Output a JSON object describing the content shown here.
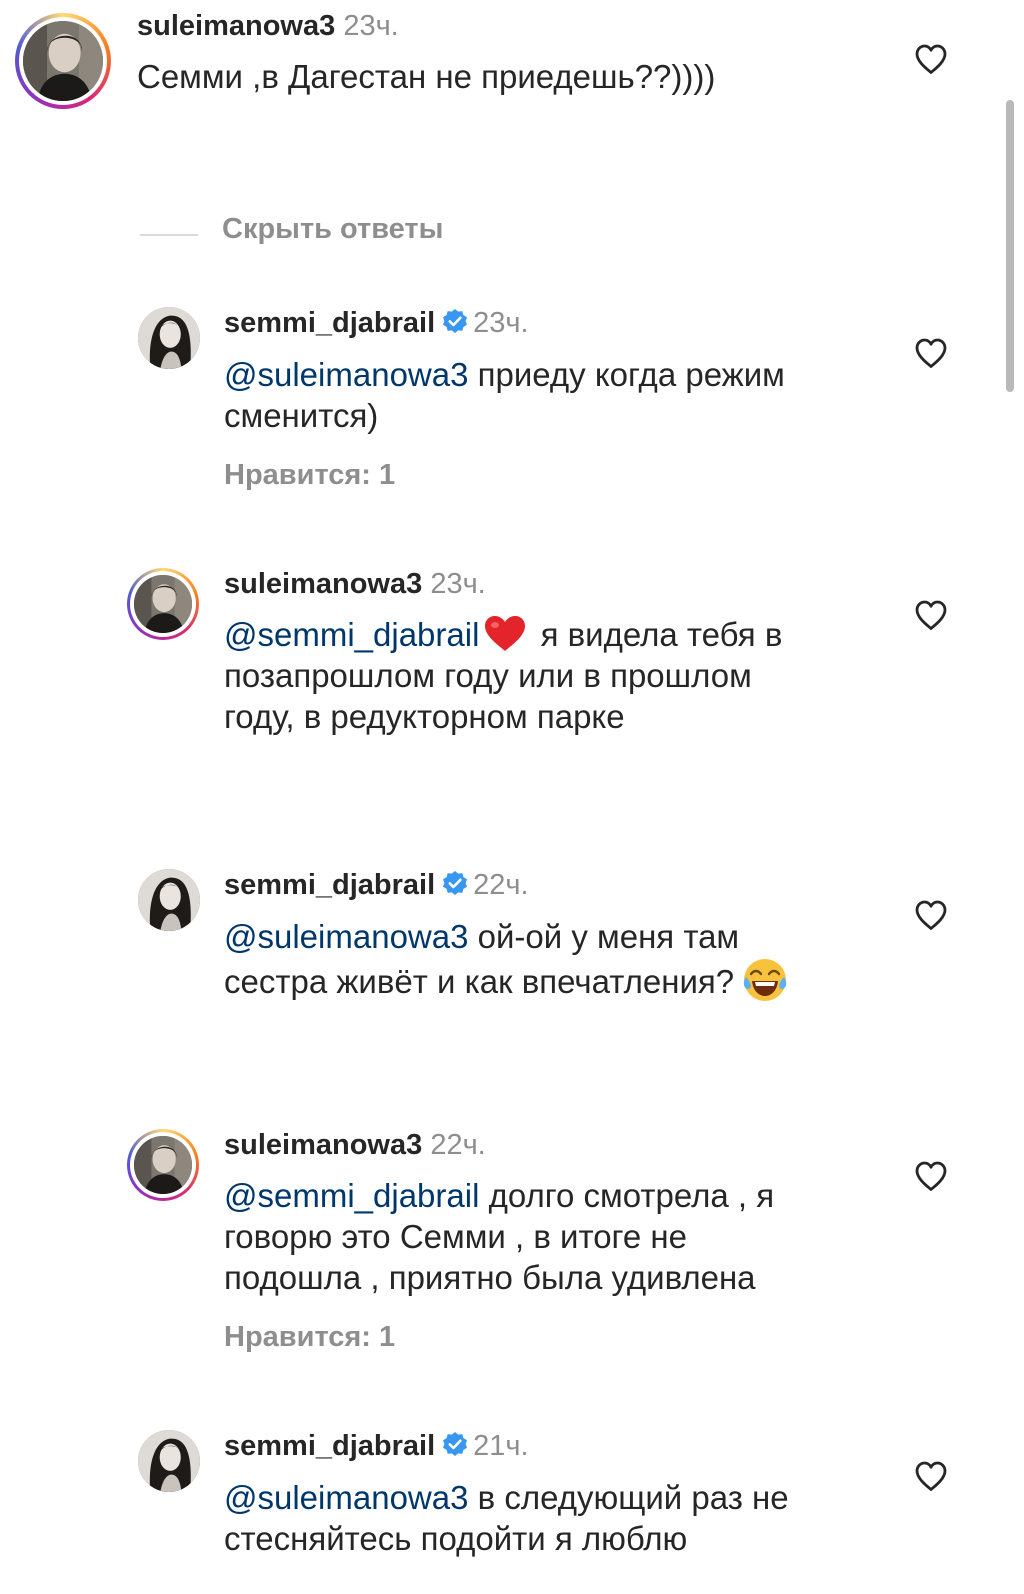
{
  "top_comment": {
    "username": "suleimanowa3",
    "time": "23ч.",
    "text": "Семми ,в Дагестан не приедешь??))))"
  },
  "hide_replies_label": "Скрыть ответы",
  "replies": [
    {
      "username": "semmi_djabrail",
      "verified": true,
      "time": "23ч.",
      "mention": "@suleimanowa3",
      "line1": " приеду когда режим",
      "line2": "сменится)",
      "likes": "Нравится: 1"
    },
    {
      "username": "suleimanowa3",
      "verified": false,
      "time": "23ч.",
      "mention": "@semmi_djabrail",
      "emoji": "red-heart",
      "line1": " я видела тебя в",
      "line2": "позапрошлом году или в прошлом",
      "line3": "году, в редукторном парке"
    },
    {
      "username": "semmi_djabrail",
      "verified": true,
      "time": "22ч.",
      "mention": "@suleimanowa3",
      "line1": " ой-ой у меня там",
      "line2": "сестра живёт и как впечатления?",
      "emoji": "laughing-tears"
    },
    {
      "username": "suleimanowa3",
      "verified": false,
      "time": "22ч.",
      "mention": "@semmi_djabrail",
      "line1": " долго смотрела , я",
      "line2": "говорю это Семми , в итоге не",
      "line3": "подошла , приятно была удивлена",
      "likes": "Нравится: 1"
    },
    {
      "username": "semmi_djabrail",
      "verified": true,
      "time": "21ч.",
      "mention": "@suleimanowa3",
      "line1": " в следующий раз не",
      "line2": "стесняйтесь подойти я люблю"
    }
  ],
  "icons": {
    "like": "heart-outline-icon",
    "verified": "verified-badge-icon"
  },
  "colors": {
    "mention": "#00376b",
    "verified": "#3897f0",
    "muted": "#8e8e8e",
    "story_ring": "#d62976"
  }
}
